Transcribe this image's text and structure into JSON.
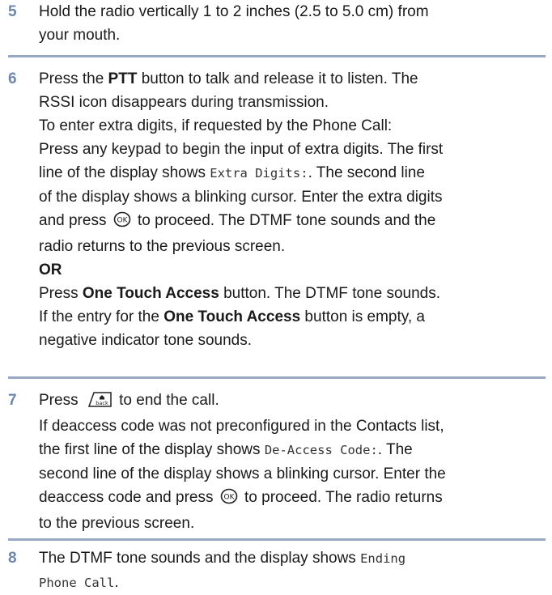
{
  "steps": [
    {
      "number": "5",
      "line1": "Hold the radio vertically 1 to 2 inches (2.5 to 5.0 cm) from",
      "line2": "your mouth."
    },
    {
      "number": "6",
      "a_pre": "Press the ",
      "a_bold": "PTT",
      "a_post": " button to talk and release it to listen. The",
      "b": "RSSI icon disappears during transmission.",
      "c": "To enter extra digits, if requested by the Phone Call:",
      "d": "Press any keypad to begin the input of extra digits. The first",
      "e_pre": "line of the display shows ",
      "e_mono": "Extra Digits:",
      "e_post": ". The second line",
      "f": "of the display shows a blinking cursor. Enter the extra digits",
      "g_pre": "and press ",
      "g_post": " to proceed. The DTMF tone sounds and the",
      "h": "radio returns to the previous screen.",
      "or": "OR",
      "i_pre": "Press ",
      "i_bold": "One Touch Access",
      "i_post": " button. The DTMF tone sounds.",
      "j_pre": "If the entry for the ",
      "j_bold": "One Touch Access",
      "j_post": " button is empty, a",
      "k": "negative indicator tone sounds."
    },
    {
      "number": "7",
      "a_pre": "Press ",
      "a_post": " to end the call.",
      "b": "If deaccess code was not preconfigured in the Contacts list,",
      "c_pre": "the first line of the display shows ",
      "c_mono": "De-Access Code:",
      "c_post": ". The",
      "d": "second line of the display shows a blinking cursor. Enter the",
      "e_pre": "deaccess code and press ",
      "e_post": " to proceed. The radio returns",
      "f": "to the previous screen."
    },
    {
      "number": "8",
      "a_pre": "The DTMF tone sounds and the display shows ",
      "a_mono": "Ending",
      "b_mono": "Phone Call",
      "b_post": "."
    }
  ],
  "icons": {
    "ok_button": "ok-button-icon",
    "back_home_button": "back-home-button-icon",
    "back_label": "back"
  },
  "colors": {
    "step_number": "#6b86b0",
    "rule": "#97a9c3"
  }
}
